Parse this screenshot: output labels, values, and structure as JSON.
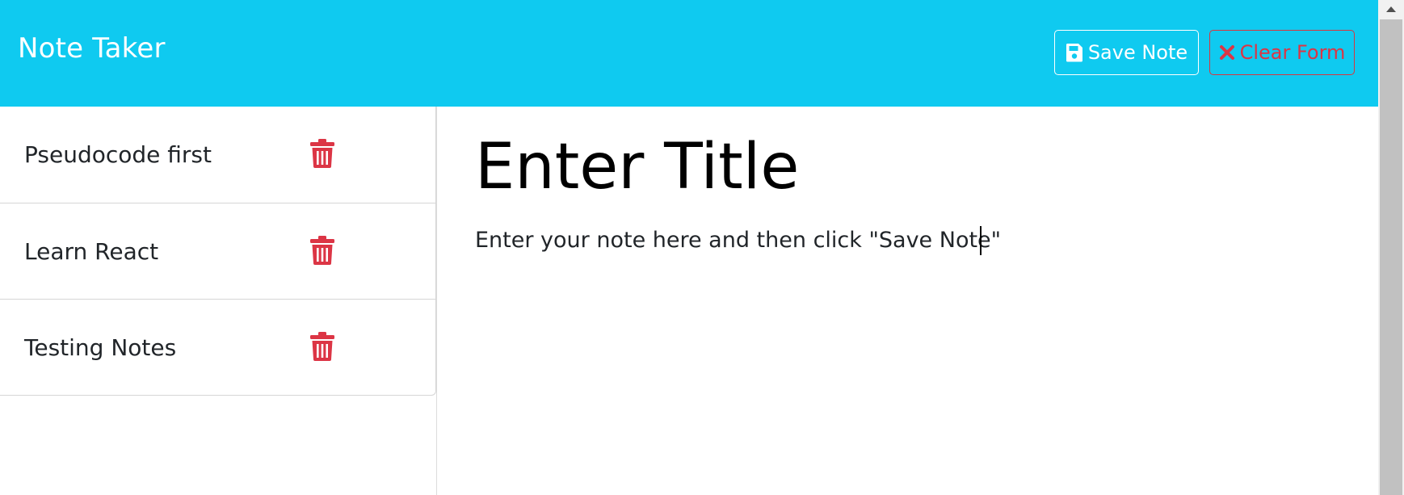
{
  "app": {
    "brand": "Note Taker"
  },
  "toolbar": {
    "save_label": "Save Note",
    "save_icon": "floppy-disk-icon",
    "clear_label": "Clear Form",
    "clear_icon": "x-mark-icon"
  },
  "notes": [
    {
      "title": "Pseudocode first"
    },
    {
      "title": "Learn React"
    },
    {
      "title": "Testing Notes"
    }
  ],
  "editor": {
    "title_placeholder": "Enter Title",
    "title_value": "",
    "body_placeholder": "Enter your note here and then click \"Save Note\"",
    "body_value": ""
  },
  "colors": {
    "navbar": "#0fcaf0",
    "danger": "#dc3545",
    "white": "#ffffff"
  }
}
